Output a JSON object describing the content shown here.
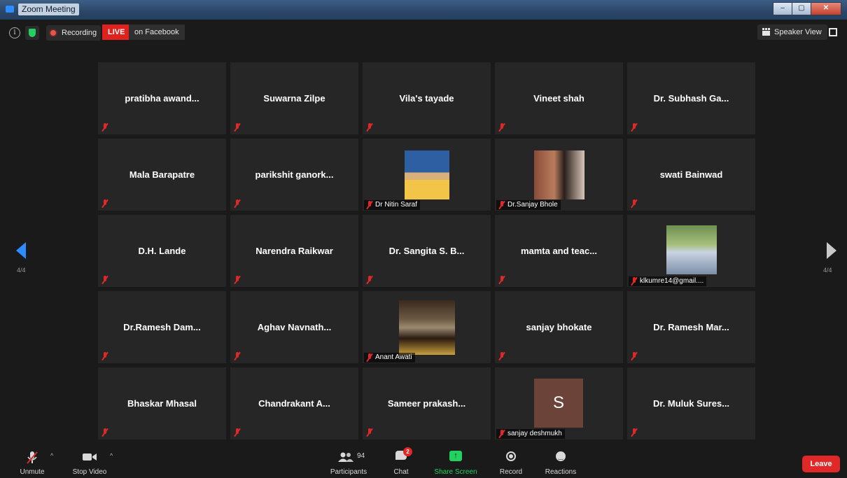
{
  "window": {
    "title": "Zoom Meeting",
    "controls": [
      "–",
      "▢",
      "✕"
    ]
  },
  "topbar": {
    "recording_label": "Recording",
    "live_label": "LIVE",
    "live_target": "on Facebook",
    "speaker_view_label": "Speaker View",
    "colors": {
      "live": "#e0221f",
      "shield": "#23d160"
    }
  },
  "grid": {
    "page_indicator": "4/4",
    "tiles": [
      {
        "name": "pratibha  awand...",
        "video": false
      },
      {
        "name": "Suwarna Zilpe",
        "video": false
      },
      {
        "name": "Vila's tayade",
        "video": false
      },
      {
        "name": "Vineet shah",
        "video": false
      },
      {
        "name": "Dr. Subhash Ga...",
        "video": false
      },
      {
        "name": "Mala Barapatre",
        "video": false
      },
      {
        "name": "parikshit  ganork...",
        "video": false
      },
      {
        "name": "Dr Nitin Saraf",
        "video": true
      },
      {
        "name": "Dr.Sanjay Bhole",
        "video": true
      },
      {
        "name": "swati Bainwad",
        "video": false
      },
      {
        "name": "D.H. Lande",
        "video": false
      },
      {
        "name": "Narendra Raikwar",
        "video": false
      },
      {
        "name": "Dr. Sangita S. B...",
        "video": false
      },
      {
        "name": "mamta and teac...",
        "video": false
      },
      {
        "name": "klkumre14@gmail....",
        "video": true
      },
      {
        "name": "Dr.Ramesh Dam...",
        "video": false
      },
      {
        "name": "Aghav  Navnath...",
        "video": false
      },
      {
        "name": "Anant Awati",
        "video": true
      },
      {
        "name": "sanjay bhokate",
        "video": false
      },
      {
        "name": "Dr. Ramesh Mar...",
        "video": false
      },
      {
        "name": "Bhaskar Mhasal",
        "video": false
      },
      {
        "name": "Chandrakant  A...",
        "video": false
      },
      {
        "name": "Sameer  prakash...",
        "video": false
      },
      {
        "name": "sanjay deshmukh",
        "video": false,
        "avatar_letter": "S"
      },
      {
        "name": "Dr. Muluk Sures...",
        "video": false
      }
    ]
  },
  "toolbar": {
    "unmute": "Unmute",
    "stop_video": "Stop Video",
    "participants": "Participants",
    "participants_count": "94",
    "chat": "Chat",
    "chat_badge": "2",
    "share_screen": "Share Screen",
    "record": "Record",
    "reactions": "Reactions",
    "leave": "Leave",
    "colors": {
      "share": "#23d160",
      "leave": "#e02828"
    }
  }
}
